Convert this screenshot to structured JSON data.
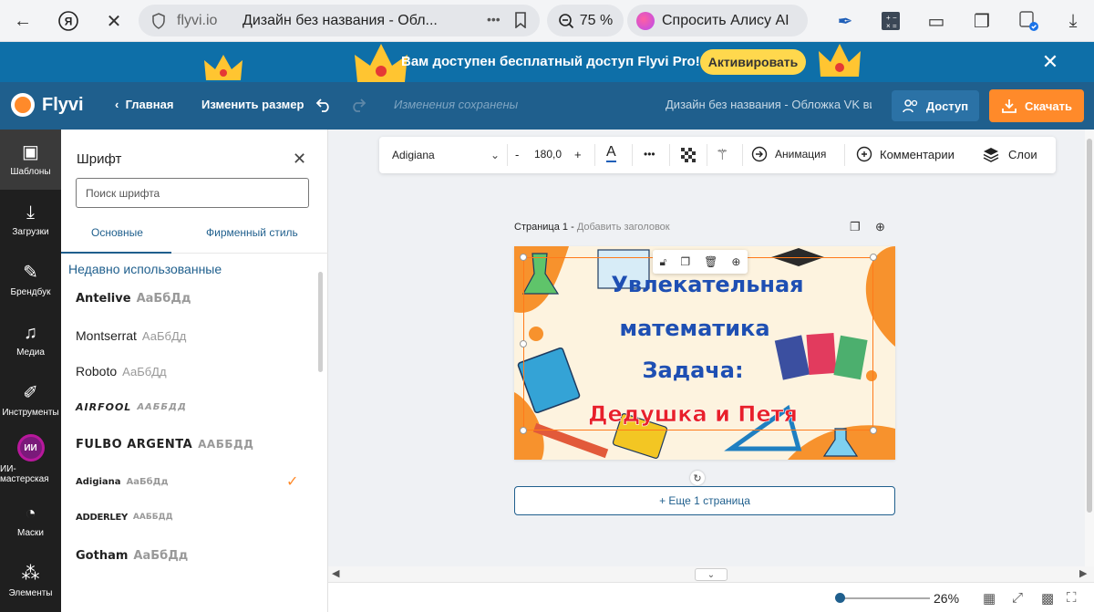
{
  "browser": {
    "host": "flyvi.io",
    "tab_title": "Дизайн без названия - Обл...",
    "zoom": "75 %",
    "alice_label": "Спросить Алису AI",
    "more": "•••"
  },
  "promo": {
    "text": "Вам доступен бесплатный доступ Flyvi Pro!",
    "button": "Активировать",
    "close": "✕"
  },
  "header": {
    "logo": "Flyvi",
    "home": "Главная",
    "resize": "Изменить размер",
    "saved": "Изменения сохранены",
    "doc_name": "Дизайн без названия - Обложка VK вид...",
    "access": "Доступ",
    "download": "Скачать"
  },
  "nav": [
    {
      "label": "Шаблоны",
      "icon": "templates-icon"
    },
    {
      "label": "Загрузки",
      "icon": "upload-icon"
    },
    {
      "label": "Брендбук",
      "icon": "brandbook-icon"
    },
    {
      "label": "Медиа",
      "icon": "media-icon"
    },
    {
      "label": "Инструменты",
      "icon": "tools-icon"
    },
    {
      "label": "ИИ-мастерская",
      "icon": "ai-icon",
      "badge": "ИИ"
    },
    {
      "label": "Маски",
      "icon": "masks-icon"
    },
    {
      "label": "Элементы",
      "icon": "elements-icon"
    }
  ],
  "panel": {
    "title": "Шрифт",
    "search_placeholder": "Поиск шрифта",
    "tabs": [
      "Основные",
      "Фирменный стиль"
    ],
    "recent_label": "Недавно использованные",
    "fonts": [
      {
        "name": "Antelive",
        "sample": "АаБбДд"
      },
      {
        "name": "Montserrat",
        "sample": "АаБбДд"
      },
      {
        "name": "Roboto",
        "sample": "АаБбДд"
      },
      {
        "name": "AIRFOOL",
        "sample": "ААББДД"
      },
      {
        "name": "FULBO ARGENTA",
        "sample": "ААББДД"
      },
      {
        "name": "Adigiana",
        "sample": "АаБбДд",
        "selected": true
      },
      {
        "name": "ADDERLEY",
        "sample": "ААББДД"
      },
      {
        "name": "Gotham",
        "sample": "АаБбДд"
      }
    ]
  },
  "toolbar": {
    "font": "Adigiana",
    "minus": "-",
    "size": "180,0",
    "plus": "+",
    "more": "•••",
    "animation": "Анимация",
    "comments": "Комментарии",
    "layers": "Слои"
  },
  "page": {
    "label": "Страница 1 -",
    "add_title": "Добавить заголовок",
    "add_page": "+ Еще 1 страница"
  },
  "canvas_text": {
    "line1": "Увлекательная",
    "line2": "математика",
    "line3": "Задача:",
    "line4": "Дедушка и Петя"
  },
  "status": {
    "zoom": "26%",
    "zoom_level": 0.26
  },
  "colors": {
    "brand_blue": "#1f5f8d",
    "accent_orange": "#ff8a2a",
    "title_blue": "#1e4fb3",
    "title_red": "#e8202a"
  }
}
